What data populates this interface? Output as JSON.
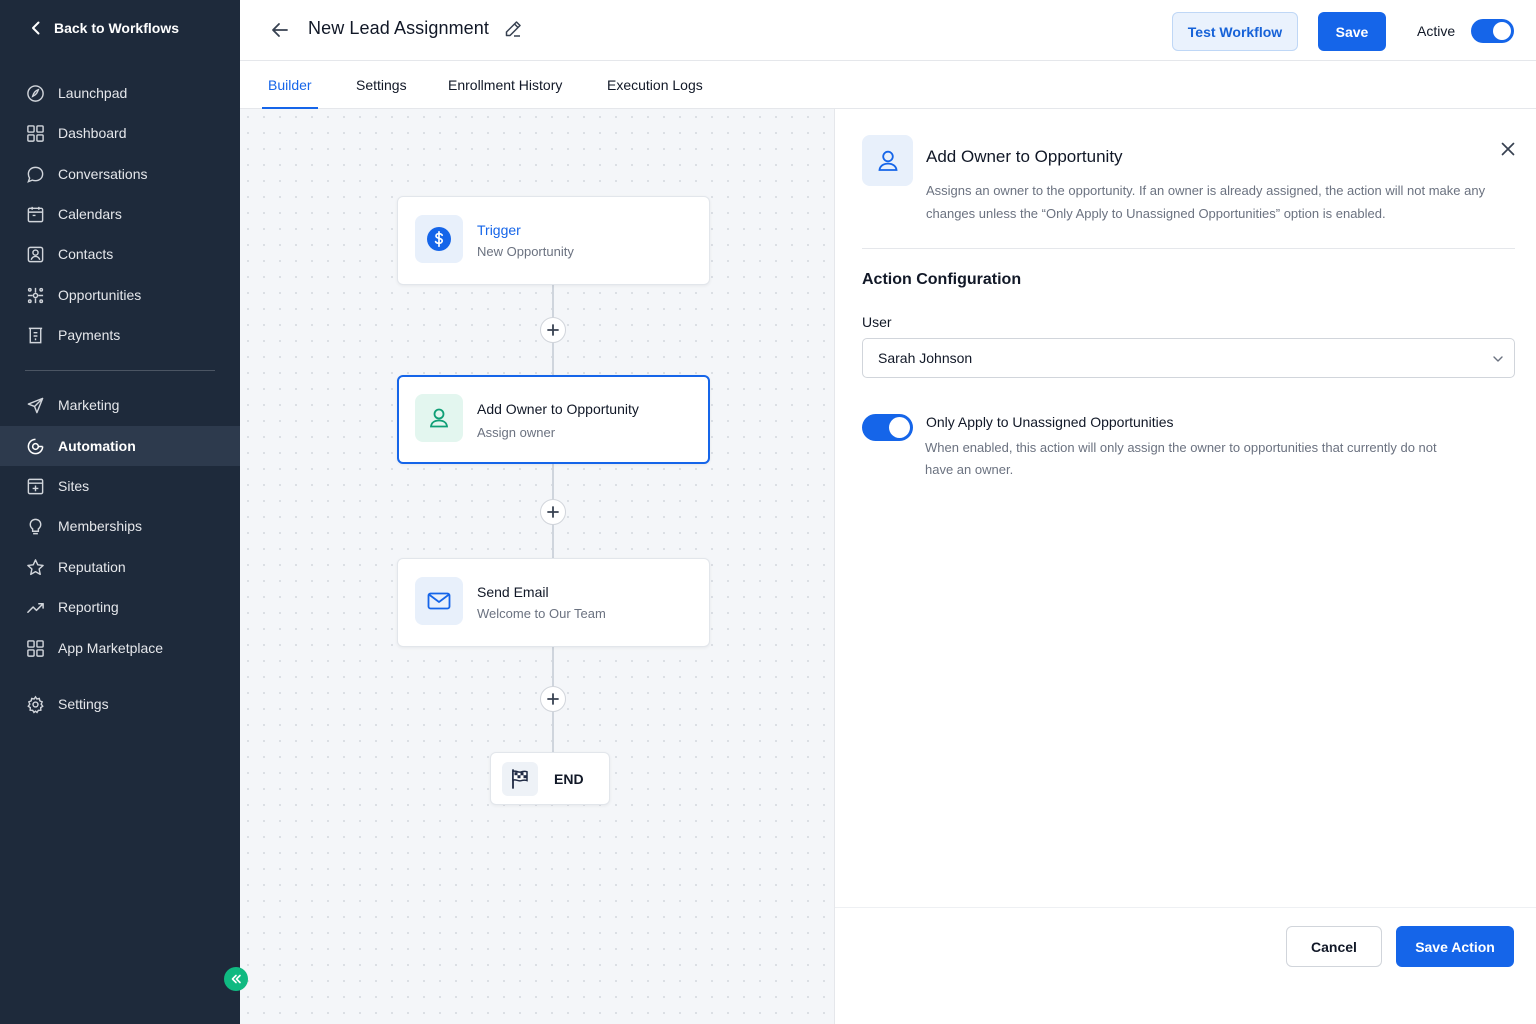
{
  "sidebar": {
    "back_label": "Back to Workflows",
    "items": [
      {
        "label": "Launchpad",
        "icon": "launchpad-icon"
      },
      {
        "label": "Dashboard",
        "icon": "dashboard-icon"
      },
      {
        "label": "Conversations",
        "icon": "chat-bubble-icon"
      },
      {
        "label": "Calendars",
        "icon": "calendar-icon"
      },
      {
        "label": "Contacts",
        "icon": "contact-card-icon"
      },
      {
        "label": "Opportunities",
        "icon": "opportunities-icon"
      },
      {
        "label": "Payments",
        "icon": "receipt-icon"
      },
      {
        "label": "Marketing",
        "icon": "send-icon"
      },
      {
        "label": "Automation",
        "icon": "automation-icon",
        "active": true
      },
      {
        "label": "Sites",
        "icon": "sites-icon"
      },
      {
        "label": "Memberships",
        "icon": "lightbulb-icon"
      },
      {
        "label": "Reputation",
        "icon": "star-icon"
      },
      {
        "label": "Reporting",
        "icon": "trend-icon"
      },
      {
        "label": "App Marketplace",
        "icon": "apps-grid-icon"
      },
      {
        "label": "Settings",
        "icon": "gear-icon"
      }
    ]
  },
  "header": {
    "title": "New Lead Assignment",
    "test_label": "Test Workflow",
    "save_label": "Save",
    "active_label": "Active",
    "active": true
  },
  "tabs": [
    {
      "label": "Builder",
      "active": true
    },
    {
      "label": "Settings"
    },
    {
      "label": "Enrollment History"
    },
    {
      "label": "Execution Logs"
    }
  ],
  "workflow": {
    "nodes": [
      {
        "title": "Trigger",
        "subtitle": "New Opportunity",
        "icon": "dollar-circle-icon"
      },
      {
        "title": "Add Owner to Opportunity",
        "subtitle": "Assign owner",
        "icon": "user-icon",
        "selected": true
      },
      {
        "title": "Send Email",
        "subtitle": "Welcome to Our Team",
        "icon": "mail-icon"
      }
    ],
    "end_label": "END"
  },
  "panel": {
    "title": "Add Owner to Opportunity",
    "description": "Assigns an owner to the opportunity. If an owner is already assigned, the action will not make any changes unless the “Only Apply to Unassigned Opportunities” option is enabled.",
    "section_title": "Action Configuration",
    "user_label": "User",
    "user_value": "Sarah Johnson",
    "toggle_title": "Only Apply to Unassigned Opportunities",
    "toggle_desc": "When enabled, this action will only assign the owner to opportunities that currently do not have an owner.",
    "toggle_on": true,
    "cancel_label": "Cancel",
    "save_action_label": "Save Action"
  },
  "colors": {
    "primary": "#1565e9",
    "sidebar_bg": "#1e2a3b",
    "accent_green": "#10b981"
  }
}
